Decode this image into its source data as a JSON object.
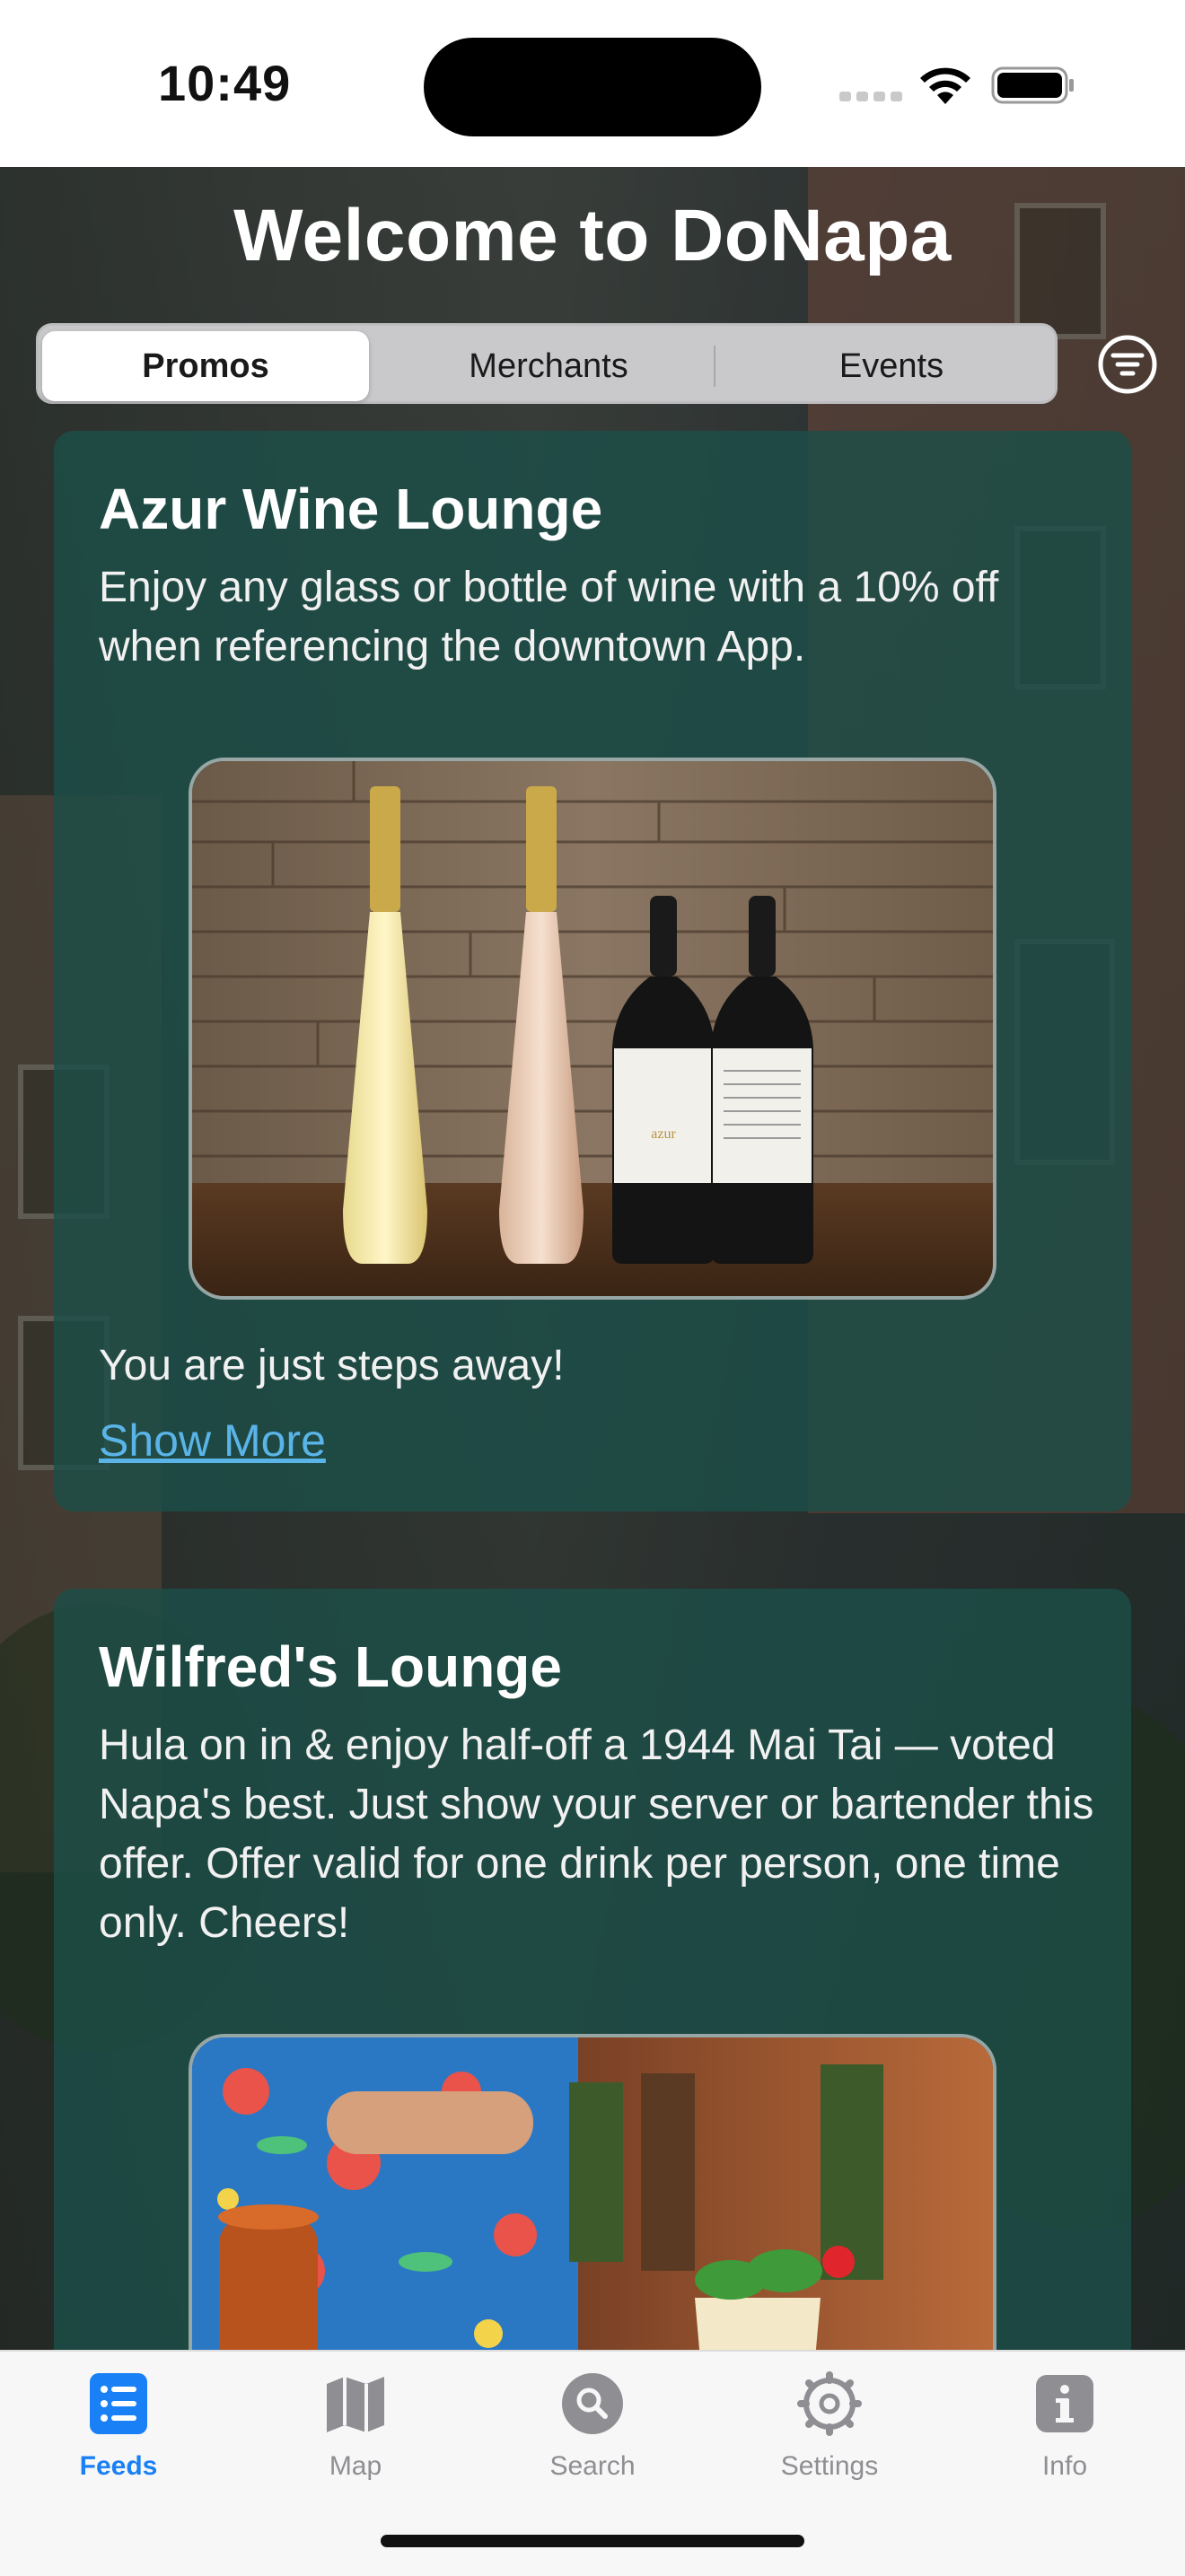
{
  "status_bar": {
    "time": "10:49"
  },
  "header": {
    "title": "Welcome to DoNapa"
  },
  "segments": [
    {
      "label": "Promos",
      "selected": true
    },
    {
      "label": "Merchants",
      "selected": false
    },
    {
      "label": "Events",
      "selected": false
    }
  ],
  "filter_icon": "filter-lines-icon",
  "promos": [
    {
      "title": "Azur Wine Lounge",
      "description": "Enjoy any glass or bottle of wine with a 10% off when referencing the downtown App.",
      "image_label": "azur",
      "footer": "You are just steps away!",
      "link": "Show More"
    },
    {
      "title": "Wilfred's Lounge",
      "description": "Hula on in & enjoy half-off a 1944 Mai Tai — voted Napa's best. Just show your server or bartender this offer. Offer valid for one drink per person, one time only. Cheers!"
    }
  ],
  "tabs": [
    {
      "label": "Feeds",
      "icon": "list-icon",
      "active": true
    },
    {
      "label": "Map",
      "icon": "map-icon",
      "active": false
    },
    {
      "label": "Search",
      "icon": "search-icon",
      "active": false
    },
    {
      "label": "Settings",
      "icon": "gear-icon",
      "active": false
    },
    {
      "label": "Info",
      "icon": "info-icon",
      "active": false
    }
  ],
  "colors": {
    "accent": "#1a80f5",
    "card": "#1c4e48",
    "link": "#5ab4e8"
  }
}
